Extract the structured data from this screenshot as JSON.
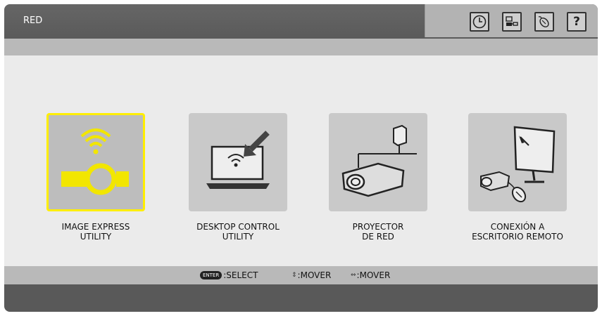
{
  "header": {
    "title": "RED"
  },
  "toolbar": {
    "icons": [
      "clock-icon",
      "network-icon",
      "mouse-icon",
      "help-icon"
    ],
    "help_label": "?"
  },
  "tiles": [
    {
      "label": "IMAGE EXPRESS\nUTILITY",
      "selected": true
    },
    {
      "label": "DESKTOP CONTROL\nUTILITY",
      "selected": false
    },
    {
      "label": "PROYECTOR\nDE RED",
      "selected": false
    },
    {
      "label": "CONEXIÓN A\nESCRITORIO REMOTO",
      "selected": false
    }
  ],
  "status": {
    "enter_key": "ENTER",
    "select_label": ":SELECT",
    "updown_label": ":MOVER",
    "leftright_label": ":MOVER"
  },
  "colors": {
    "selected_border": "#ffee00",
    "icon_yellow": "#f2e600",
    "title_bar": "#5f5f5f"
  }
}
